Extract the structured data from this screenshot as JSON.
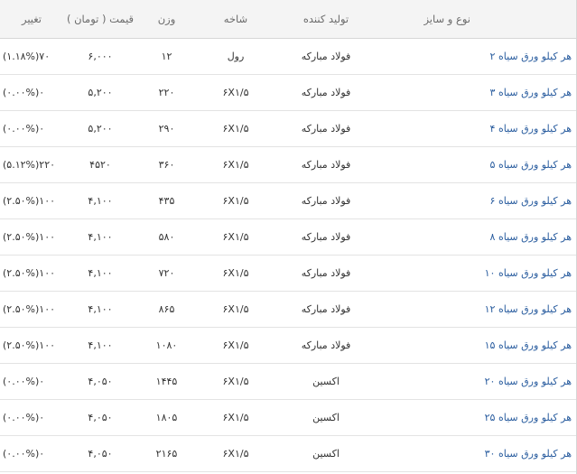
{
  "colors": {
    "positive": "#2fae2f",
    "link": "#2a5d9f",
    "header_bg": "#f4f4f4"
  },
  "header": {
    "name": "نوع و سایز",
    "producer": "تولید کننده",
    "branch": "شاخه",
    "weight": "وزن",
    "price": "قیمت ( تومان )",
    "change": "تغییر"
  },
  "rows": [
    {
      "name": "هر کیلو ورق سیاه ۲",
      "producer": "فولاد مبارکه",
      "branch": "رول",
      "weight": "۱۲",
      "price": "۶,۰۰۰",
      "change": "۷۰(۱.۱۸%)",
      "change_dir": "pos"
    },
    {
      "name": "هر کیلو ورق سیاه ۳",
      "producer": "فولاد مبارکه",
      "branch": "۶X۱/۵",
      "weight": "۲۲۰",
      "price": "۵,۲۰۰",
      "change": "۰(۰.۰۰%)",
      "change_dir": "zero"
    },
    {
      "name": "هر کیلو ورق سیاه ۴",
      "producer": "فولاد مبارکه",
      "branch": "۶X۱/۵",
      "weight": "۲۹۰",
      "price": "۵,۲۰۰",
      "change": "۰(۰.۰۰%)",
      "change_dir": "zero"
    },
    {
      "name": "هر کیلو ورق سیاه ۵",
      "producer": "فولاد مبارکه",
      "branch": "۶X۱/۵",
      "weight": "۳۶۰",
      "price": "۴۵۲۰",
      "change": "۲۲۰(۵.۱۲%)",
      "change_dir": "pos"
    },
    {
      "name": "هر کیلو ورق سیاه ۶",
      "producer": "فولاد مبارکه",
      "branch": "۶X۱/۵",
      "weight": "۴۳۵",
      "price": "۴,۱۰۰",
      "change": "۱۰۰(۲.۵۰%)",
      "change_dir": "pos"
    },
    {
      "name": "هر کیلو ورق سیاه ۸",
      "producer": "فولاد مبارکه",
      "branch": "۶X۱/۵",
      "weight": "۵۸۰",
      "price": "۴,۱۰۰",
      "change": "۱۰۰(۲.۵۰%)",
      "change_dir": "pos"
    },
    {
      "name": "هر کیلو ورق سیاه ۱۰",
      "producer": "فولاد مبارکه",
      "branch": "۶X۱/۵",
      "weight": "۷۲۰",
      "price": "۴,۱۰۰",
      "change": "۱۰۰(۲.۵۰%)",
      "change_dir": "pos"
    },
    {
      "name": "هر کیلو ورق سیاه ۱۲",
      "producer": "فولاد مبارکه",
      "branch": "۶X۱/۵",
      "weight": "۸۶۵",
      "price": "۴,۱۰۰",
      "change": "۱۰۰(۲.۵۰%)",
      "change_dir": "pos"
    },
    {
      "name": "هر کیلو ورق سیاه ۱۵",
      "producer": "فولاد مبارکه",
      "branch": "۶X۱/۵",
      "weight": "۱۰۸۰",
      "price": "۴,۱۰۰",
      "change": "۱۰۰(۲.۵۰%)",
      "change_dir": "pos"
    },
    {
      "name": "هر کیلو ورق سیاه ۲۰",
      "producer": "اکسین",
      "branch": "۶X۱/۵",
      "weight": "۱۴۴۵",
      "price": "۴,۰۵۰",
      "change": "۰(۰.۰۰%)",
      "change_dir": "zero"
    },
    {
      "name": "هر کیلو ورق سیاه ۲۵",
      "producer": "اکسین",
      "branch": "۶X۱/۵",
      "weight": "۱۸۰۵",
      "price": "۴,۰۵۰",
      "change": "۰(۰.۰۰%)",
      "change_dir": "zero"
    },
    {
      "name": "هر کیلو ورق سیاه ۳۰",
      "producer": "اکسین",
      "branch": "۶X۱/۵",
      "weight": "۲۱۶۵",
      "price": "۴,۰۵۰",
      "change": "۰(۰.۰۰%)",
      "change_dir": "zero"
    }
  ]
}
